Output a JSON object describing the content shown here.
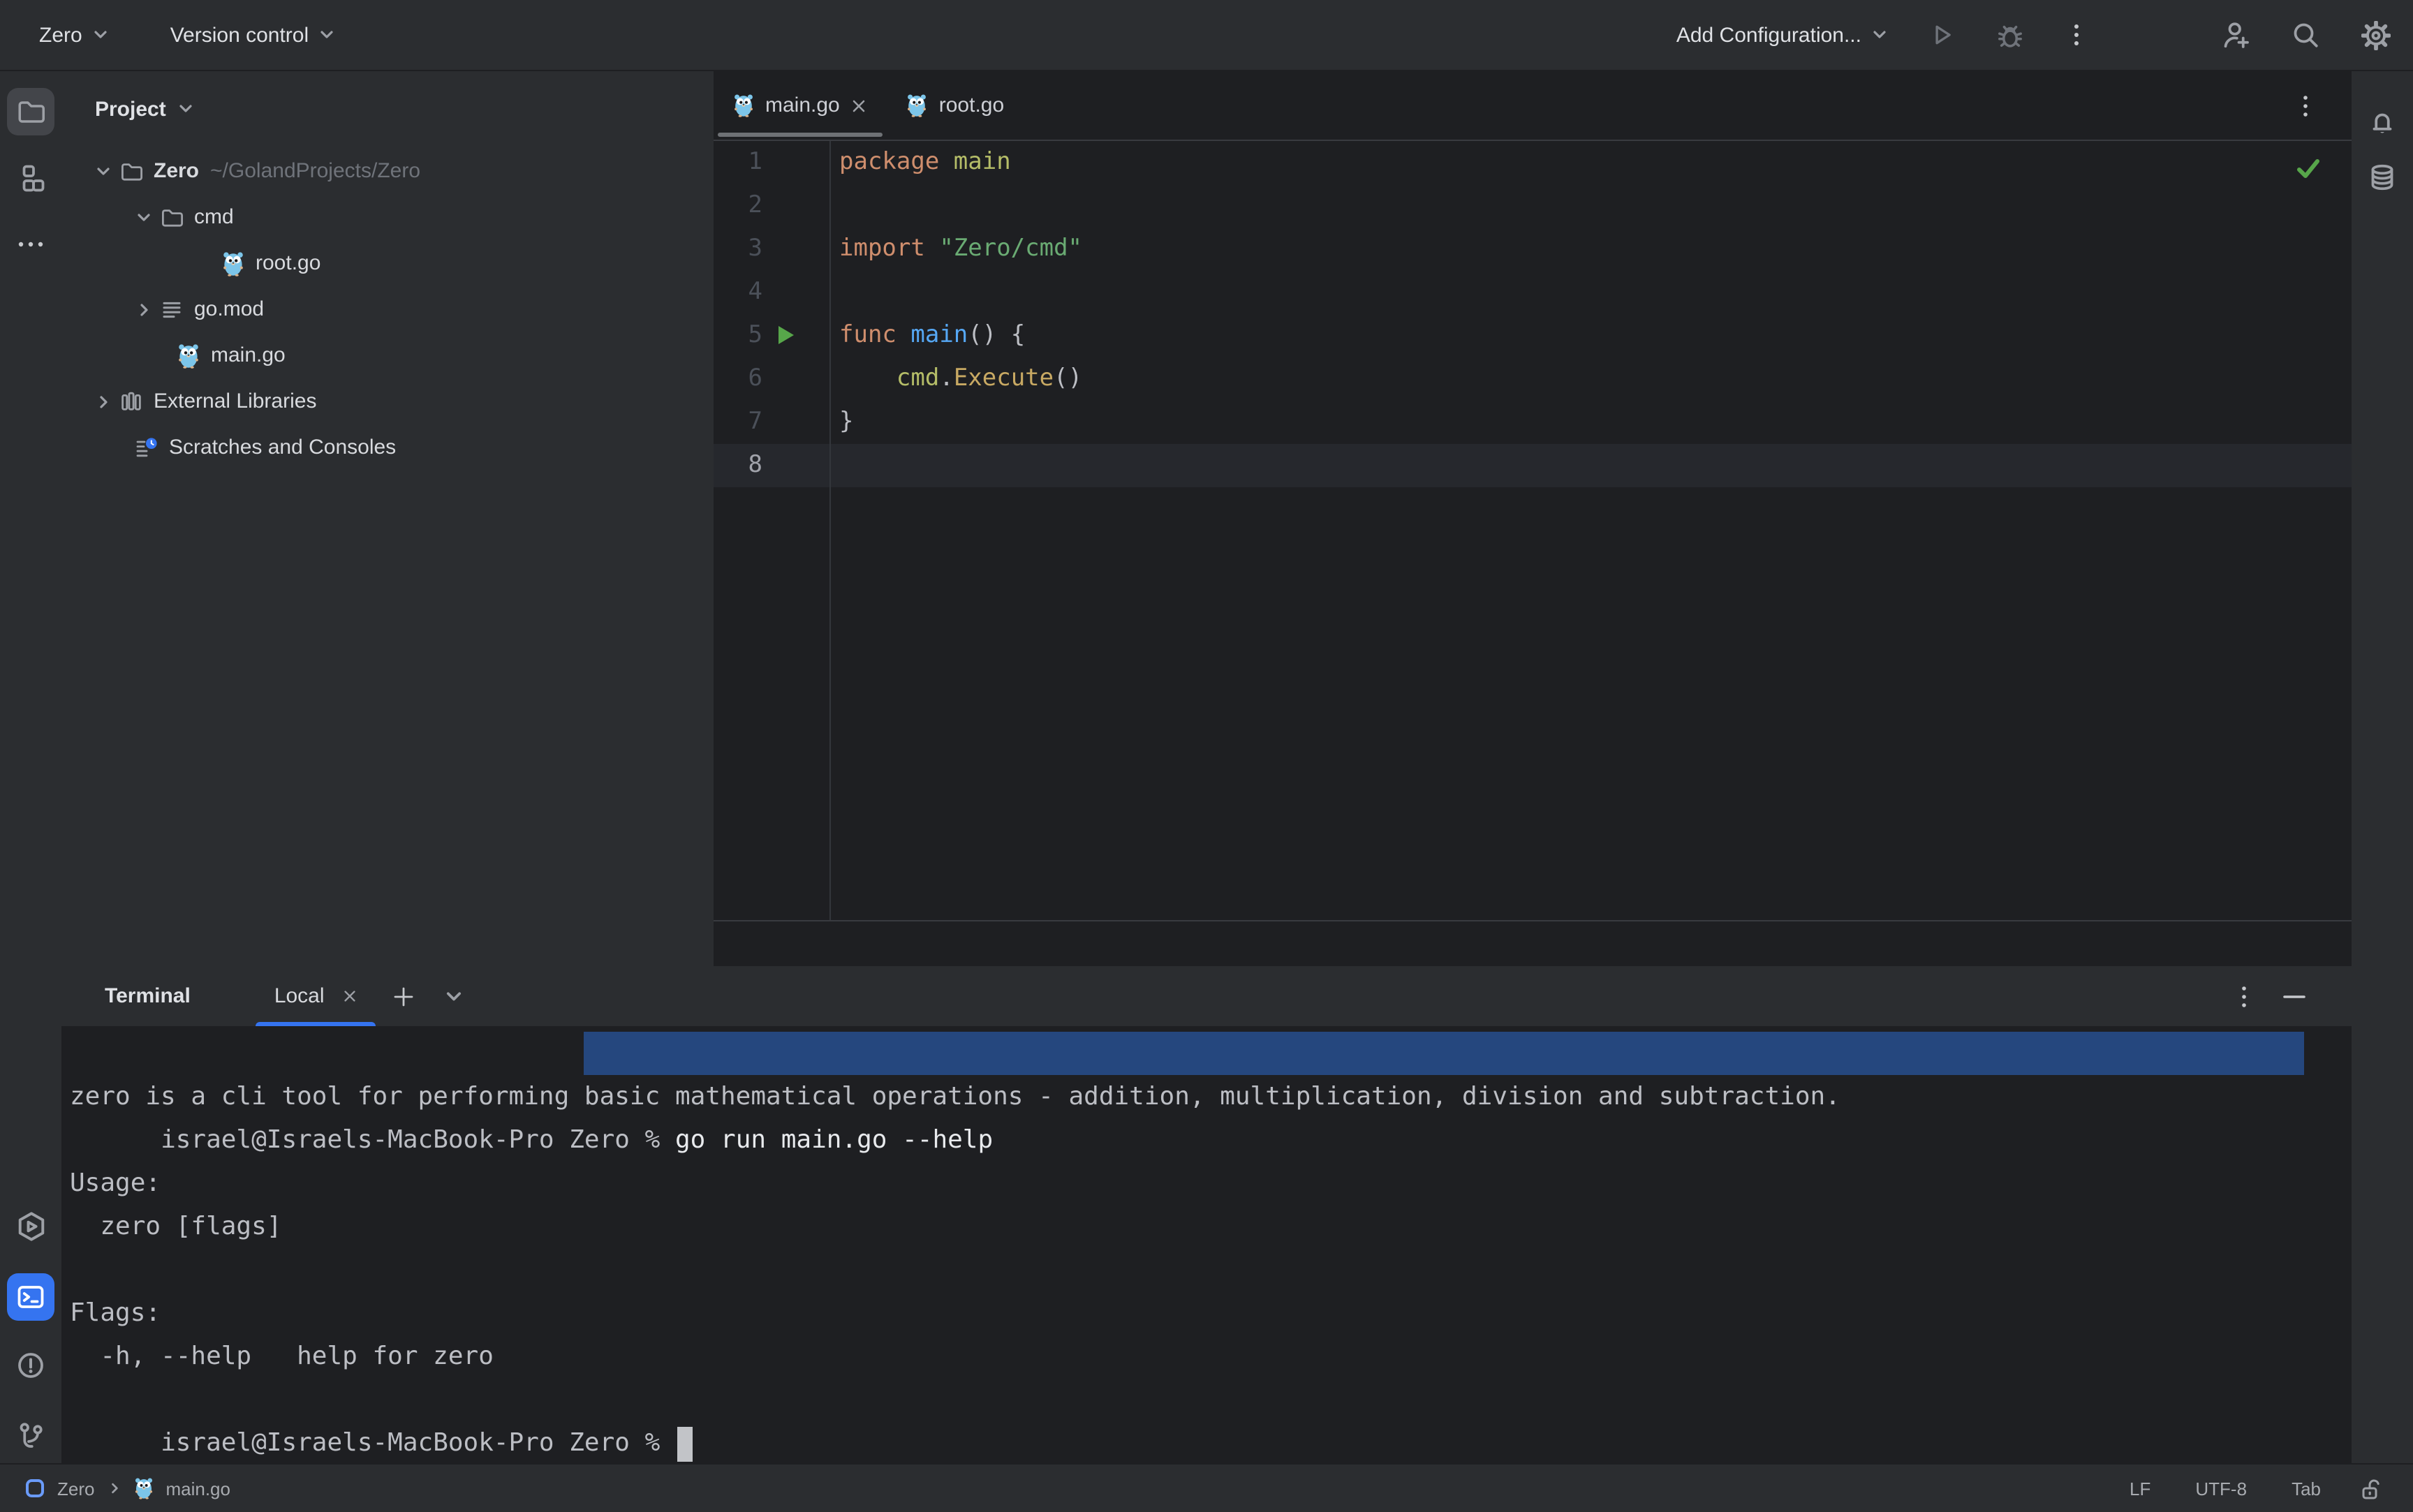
{
  "topbar": {
    "project_menu": "Zero",
    "vcs_menu": "Version control",
    "run_config": "Add Configuration..."
  },
  "project_panel": {
    "header": "Project",
    "tree": [
      {
        "label": "Zero",
        "path": "~/GolandProjects/Zero"
      },
      {
        "label": "cmd"
      },
      {
        "label": "root.go"
      },
      {
        "label": "go.mod"
      },
      {
        "label": "main.go"
      },
      {
        "label": "External Libraries"
      },
      {
        "label": "Scratches and Consoles"
      }
    ]
  },
  "editor": {
    "tabs": [
      {
        "label": "main.go"
      },
      {
        "label": "root.go"
      }
    ],
    "lines": [
      {
        "num": "1",
        "tokens": [
          {
            "c": "kw",
            "t": "package"
          },
          {
            "c": "pkg",
            "t": " main"
          }
        ]
      },
      {
        "num": "2",
        "tokens": []
      },
      {
        "num": "3",
        "tokens": [
          {
            "c": "kw",
            "t": "import "
          },
          {
            "c": "str",
            "t": "\"Zero/cmd\""
          }
        ]
      },
      {
        "num": "4",
        "tokens": []
      },
      {
        "num": "5",
        "tokens": [
          {
            "c": "kw",
            "t": "func "
          },
          {
            "c": "fn",
            "t": "main"
          },
          {
            "c": "pl",
            "t": "() {"
          }
        ]
      },
      {
        "num": "6",
        "tokens": [
          {
            "c": "pkg",
            "t": "    cmd"
          },
          {
            "c": "pl",
            "t": "."
          },
          {
            "c": "call",
            "t": "Execute"
          },
          {
            "c": "pl",
            "t": "()"
          }
        ]
      },
      {
        "num": "7",
        "tokens": [
          {
            "c": "pl",
            "t": "}"
          }
        ]
      },
      {
        "num": "8",
        "tokens": []
      }
    ]
  },
  "terminal": {
    "title": "Terminal",
    "tab": "Local",
    "prompt": "israel@Israels-MacBook-Pro Zero % ",
    "command": "go run main.go --help",
    "output": [
      "zero is a cli tool for performing basic mathematical operations - addition, multiplication, division and subtraction.",
      "",
      "Usage:",
      "  zero [flags]",
      "",
      "Flags:",
      "  -h, --help   help for zero"
    ]
  },
  "statusbar": {
    "breadcrumb_project": "Zero",
    "breadcrumb_file": "main.go",
    "line_ending": "LF",
    "encoding": "UTF-8",
    "indent": "Tab"
  },
  "icons": [
    "chevron-down-icon",
    "chevron-right-icon",
    "play-icon",
    "bug-icon",
    "more-vertical-icon",
    "add-user-icon",
    "search-icon",
    "gear-icon",
    "project-folder-icon",
    "structure-icon",
    "more-horizontal-icon",
    "services-icon",
    "terminal-icon",
    "problems-icon",
    "git-branch-icon",
    "notifications-bell-icon",
    "database-icon",
    "go-gopher-icon",
    "folder-icon",
    "go-mod-icon",
    "external-libraries-icon",
    "scratches-icon",
    "close-icon",
    "plus-icon",
    "minimize-icon",
    "run-gutter-icon",
    "inspections-ok-icon",
    "unlocked-icon",
    "project-badge-icon"
  ],
  "colors": {
    "accent": "#3574F0",
    "panel_bg": "#2B2D30",
    "editor_bg": "#1E1F22",
    "terminal_selection": "#25477E",
    "keyword": "#CF8E6D",
    "string": "#6AAB73",
    "function_decl": "#56A8F5",
    "run_green": "#57A64A"
  }
}
